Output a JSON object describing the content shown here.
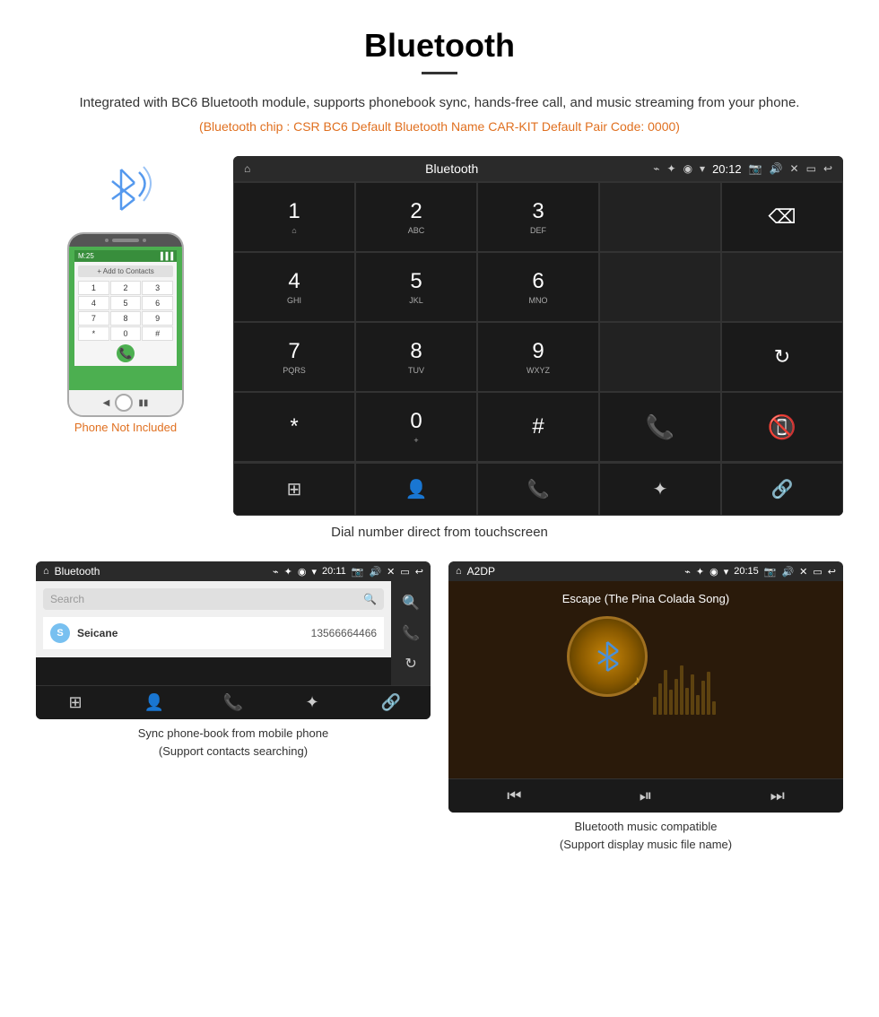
{
  "page": {
    "title": "Bluetooth",
    "description": "Integrated with BC6 Bluetooth module, supports phonebook sync, hands-free call, and music streaming from your phone.",
    "specs": "(Bluetooth chip : CSR BC6   Default Bluetooth Name CAR-KIT    Default Pair Code: 0000)"
  },
  "dialpad_screen": {
    "topbar_title": "Bluetooth",
    "topbar_time": "20:12",
    "topbar_usb_icon": "⌁",
    "keys": [
      {
        "main": "1",
        "sub": "⌂"
      },
      {
        "main": "2",
        "sub": "ABC"
      },
      {
        "main": "3",
        "sub": "DEF"
      },
      {
        "main": "",
        "sub": ""
      },
      {
        "main": "⌫",
        "sub": ""
      },
      {
        "main": "4",
        "sub": "GHI"
      },
      {
        "main": "5",
        "sub": "JKL"
      },
      {
        "main": "6",
        "sub": "MNO"
      },
      {
        "main": "",
        "sub": ""
      },
      {
        "main": "",
        "sub": ""
      },
      {
        "main": "7",
        "sub": "PQRS"
      },
      {
        "main": "8",
        "sub": "TUV"
      },
      {
        "main": "9",
        "sub": "WXYZ"
      },
      {
        "main": "",
        "sub": ""
      },
      {
        "main": "↻",
        "sub": ""
      },
      {
        "main": "*",
        "sub": ""
      },
      {
        "main": "0",
        "sub": "+"
      },
      {
        "main": "#",
        "sub": ""
      },
      {
        "main": "📞",
        "sub": ""
      },
      {
        "main": "📵",
        "sub": ""
      }
    ],
    "bottom_nav": [
      "⊞",
      "👤",
      "📞",
      "✦",
      "🔗"
    ],
    "dial_caption": "Dial number direct from touchscreen"
  },
  "phonebook_screen": {
    "topbar_title": "Bluetooth",
    "topbar_time": "20:11",
    "search_placeholder": "Search",
    "contact": {
      "initial": "S",
      "name": "Seicane",
      "number": "13566664466"
    },
    "side_icons": [
      "🔍",
      "📞",
      "↻"
    ],
    "bottom_nav": [
      "⊞",
      "👤",
      "📞",
      "✦",
      "🔗"
    ],
    "caption_line1": "Sync phone-book from mobile phone",
    "caption_line2": "(Support contacts searching)"
  },
  "music_screen": {
    "topbar_title": "A2DP",
    "topbar_time": "20:15",
    "song_title": "Escape (The Pina Colada Song)",
    "controls": [
      "⏮",
      "⏯",
      "⏭"
    ],
    "caption_line1": "Bluetooth music compatible",
    "caption_line2": "(Support display music file name)"
  },
  "phone_mockup": {
    "not_included": "Phone Not Included",
    "dialpad_keys": [
      "1",
      "2",
      "3",
      "4",
      "5",
      "6",
      "7",
      "8",
      "9",
      "*",
      "0",
      "#"
    ]
  }
}
